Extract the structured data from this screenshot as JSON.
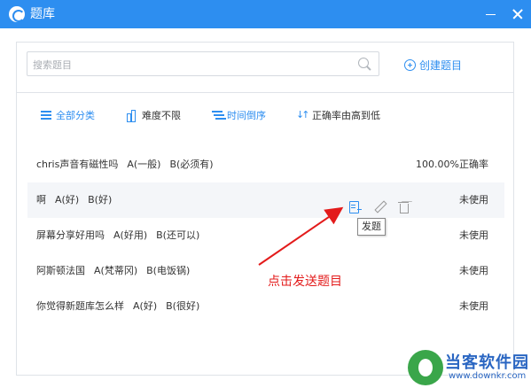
{
  "window": {
    "title": "题库",
    "icons": [
      "logo-icon",
      "minimize-icon",
      "close-icon"
    ]
  },
  "search": {
    "placeholder": "搜索题目",
    "value": "",
    "create_label": "创建题目"
  },
  "filters": [
    {
      "label": "全部分类",
      "icon": "list-icon"
    },
    {
      "label": "难度不限",
      "icon": "bar-chart-icon"
    },
    {
      "label": "时间倒序",
      "icon": "time-sort-icon"
    },
    {
      "label": "正确率由高到低",
      "icon": "sort-icon"
    }
  ],
  "questions": [
    {
      "text": "chris声音有磁性吗",
      "options": [
        "A(一般)",
        "B(必须有)"
      ],
      "status": "100.00%正确率",
      "selected": false
    },
    {
      "text": "啊",
      "options": [
        "A(好)",
        "B(好)"
      ],
      "status": "未使用",
      "selected": true
    },
    {
      "text": "屏幕分享好用吗",
      "options": [
        "A(好用)",
        "B(还可以)"
      ],
      "status": "未使用",
      "selected": false
    },
    {
      "text": "阿斯顿法国",
      "options": [
        "A(梵蒂冈)",
        "B(电饭锅)"
      ],
      "status": "未使用",
      "selected": false
    },
    {
      "text": "你觉得新题库怎么样",
      "options": [
        "A(好)",
        "B(很好)"
      ],
      "status": "未使用",
      "selected": false
    }
  ],
  "tooltip": "发题",
  "annotation": "点击发送题目",
  "watermark": {
    "text": "当客软件园",
    "url": "www.downkr.com"
  },
  "colors": {
    "titlebar": "#2d8ef0",
    "accent": "#2d8ef0",
    "annotation": "#e31b1b"
  }
}
